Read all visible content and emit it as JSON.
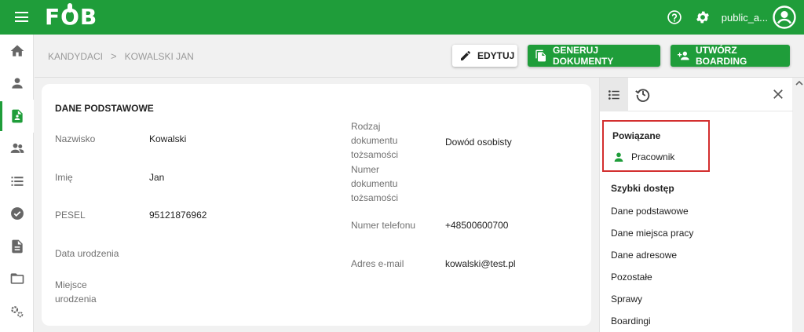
{
  "header": {
    "logo": "FOB",
    "username": "public_a..."
  },
  "breadcrumb": {
    "items": [
      "KANDYDACI",
      "KOWALSKI JAN"
    ],
    "separator": ">"
  },
  "toolbar": {
    "edit_label": "EDYTUJ",
    "generate_label": "GENERUJ DOKUMENTY",
    "boarding_label": "UTWÓRZ BOARDING"
  },
  "sidebar": {
    "items": [
      {
        "icon": "home-icon"
      },
      {
        "icon": "person-icon"
      },
      {
        "icon": "candidate-doc-icon",
        "active": true
      },
      {
        "icon": "people-icon"
      },
      {
        "icon": "list-icon"
      },
      {
        "icon": "check-circle-icon"
      },
      {
        "icon": "document-icon"
      },
      {
        "icon": "folder-open-icon"
      },
      {
        "icon": "settings-icon"
      }
    ]
  },
  "card": {
    "title": "DANE PODSTAWOWE",
    "left_fields": [
      {
        "label": "Nazwisko",
        "value": "Kowalski"
      },
      {
        "label": "Imię",
        "value": "Jan"
      },
      {
        "label": "PESEL",
        "value": "95121876962"
      },
      {
        "label": "Data urodzenia",
        "value": ""
      },
      {
        "label": "Miejsce urodzenia",
        "value": ""
      }
    ],
    "right_fields": [
      {
        "label": "Rodzaj dokumentu tożsamości",
        "value": "Dowód osobisty"
      },
      {
        "label": "Numer dokumentu tożsamości",
        "value": ""
      },
      {
        "label": "Numer telefonu",
        "value": "+48500600700"
      },
      {
        "label": "Adres e-mail",
        "value": "kowalski@test.pl"
      }
    ]
  },
  "panel": {
    "related_title": "Powiązane",
    "related_item": "Pracownik",
    "quick_title": "Szybki dostęp",
    "quick_links": [
      "Dane podstawowe",
      "Dane miejsca pracy",
      "Dane adresowe",
      "Pozostałe",
      "Sprawy",
      "Boardingi"
    ]
  },
  "colors": {
    "brand_green": "#1f9d3a",
    "highlight_red": "#d32f2f"
  }
}
